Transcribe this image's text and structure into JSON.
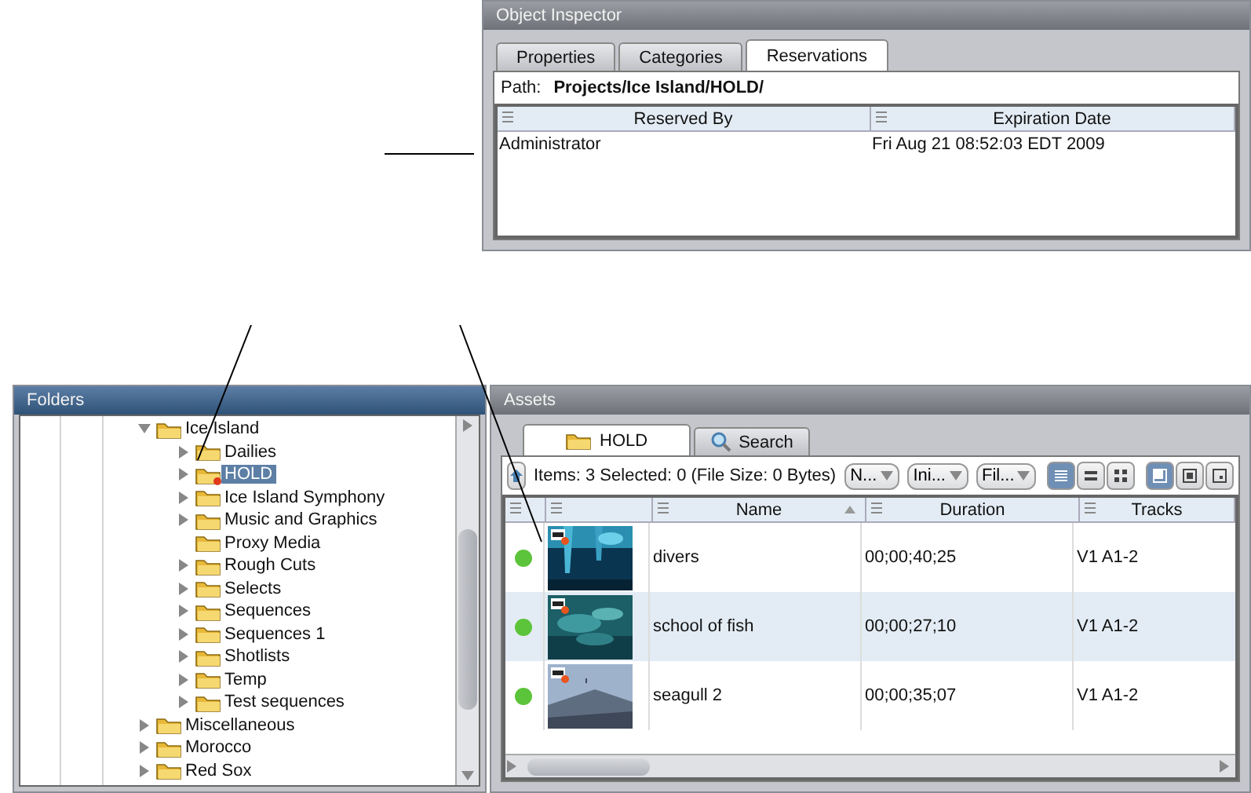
{
  "inspector": {
    "title": "Object Inspector",
    "tabs": [
      {
        "label": "Properties",
        "selected": false
      },
      {
        "label": "Categories",
        "selected": false
      },
      {
        "label": "Reservations",
        "selected": true
      }
    ],
    "path_label": "Path:",
    "path": "Projects/Ice Island/HOLD/",
    "columns": [
      "Reserved By",
      "Expiration Date"
    ],
    "rows": [
      [
        "Administrator",
        "Fri Aug 21 08:52:03 EDT 2009"
      ]
    ]
  },
  "folders": {
    "title": "Folders",
    "tree": [
      {
        "label": "Ice Island",
        "expandable": true,
        "expanded": true,
        "selected": false,
        "reserved": false,
        "children": [
          {
            "label": "Dailies",
            "expandable": true,
            "expanded": false,
            "selected": false,
            "reserved": false
          },
          {
            "label": "HOLD",
            "expandable": true,
            "expanded": false,
            "selected": true,
            "reserved": true
          },
          {
            "label": "Ice Island Symphony",
            "expandable": true,
            "expanded": false,
            "selected": false,
            "reserved": false
          },
          {
            "label": "Music and Graphics",
            "expandable": true,
            "expanded": false,
            "selected": false,
            "reserved": false
          },
          {
            "label": "Proxy Media",
            "expandable": false,
            "selected": false,
            "reserved": false
          },
          {
            "label": "Rough Cuts",
            "expandable": true,
            "expanded": false,
            "selected": false,
            "reserved": false
          },
          {
            "label": "Selects",
            "expandable": true,
            "expanded": false,
            "selected": false,
            "reserved": false
          },
          {
            "label": "Sequences",
            "expandable": true,
            "expanded": false,
            "selected": false,
            "reserved": false
          },
          {
            "label": "Sequences 1",
            "expandable": true,
            "expanded": false,
            "selected": false,
            "reserved": false
          },
          {
            "label": "Shotlists",
            "expandable": true,
            "expanded": false,
            "selected": false,
            "reserved": false
          },
          {
            "label": "Temp",
            "expandable": true,
            "expanded": false,
            "selected": false,
            "reserved": false
          },
          {
            "label": "Test sequences",
            "expandable": true,
            "expanded": false,
            "selected": false,
            "reserved": false
          }
        ]
      },
      {
        "label": "Miscellaneous",
        "expandable": true,
        "expanded": false,
        "selected": false,
        "reserved": false
      },
      {
        "label": "Morocco",
        "expandable": true,
        "expanded": false,
        "selected": false,
        "reserved": false
      },
      {
        "label": "Red Sox",
        "expandable": true,
        "expanded": false,
        "selected": false,
        "reserved": false
      }
    ]
  },
  "assets": {
    "title": "Assets",
    "tabs": [
      {
        "label": "HOLD",
        "kind": "folder",
        "selected": true
      },
      {
        "label": "Search",
        "kind": "search",
        "selected": false
      }
    ],
    "summary": "Items: 3 Selected: 0 (File Size: 0 Bytes)",
    "dropdowns": [
      "N...",
      "Ini...",
      "Fil..."
    ],
    "view_buttons": [
      {
        "kind": "list",
        "selected": true
      },
      {
        "kind": "details",
        "selected": false
      },
      {
        "kind": "grid",
        "selected": false
      },
      {
        "kind": "large",
        "selected": true
      },
      {
        "kind": "medium",
        "selected": false
      },
      {
        "kind": "small",
        "selected": false
      }
    ],
    "columns": [
      {
        "label": "Name",
        "sorted": true
      },
      {
        "label": "Duration",
        "sorted": false
      },
      {
        "label": "Tracks",
        "sorted": false
      }
    ],
    "rows": [
      {
        "color": "#5cc43a",
        "kind": "picture",
        "name": "divers",
        "duration": "00;00;40;25",
        "tracks": "V1 A1-2"
      },
      {
        "color": "#5cc43a",
        "kind": "picture",
        "name": "school of fish",
        "duration": "00;00;27;10",
        "tracks": "V1 A1-2"
      },
      {
        "color": "#5cc43a",
        "kind": "picture",
        "name": "seagull 2",
        "duration": "00;00;35;07",
        "tracks": "V1 A1-2"
      }
    ]
  }
}
